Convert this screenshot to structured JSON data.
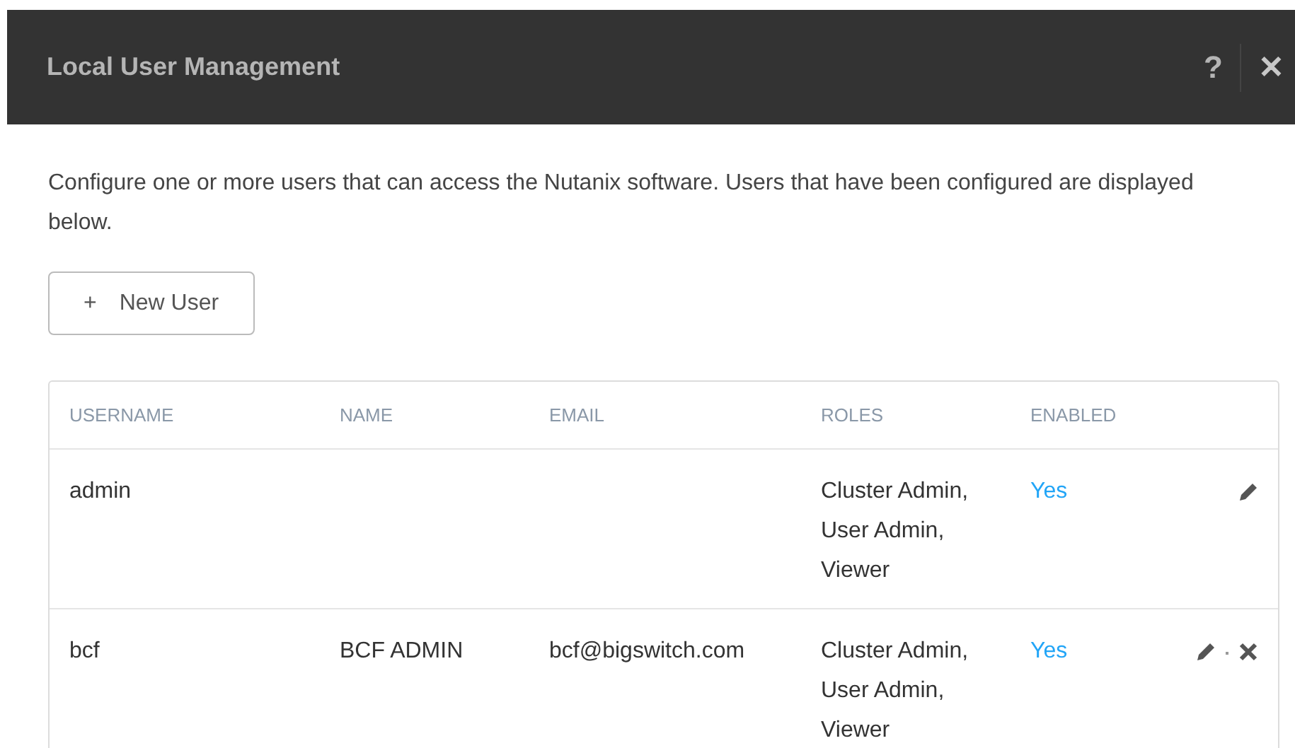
{
  "dialog": {
    "title": "Local User Management",
    "help": "?",
    "close": "✕"
  },
  "description": "Configure one or more users that can access the Nutanix software. Users that have been configured are displayed below.",
  "new_user_button": {
    "icon": "+",
    "label": "New User"
  },
  "table": {
    "columns": [
      "USERNAME",
      "NAME",
      "EMAIL",
      "ROLES",
      "ENABLED"
    ],
    "rows": [
      {
        "username": "admin",
        "roles": "Cluster Admin, User Admin, Viewer",
        "enabled": "Yes",
        "deletable": false
      },
      {
        "username": "bcf",
        "name": "BCF ADMIN",
        "email": "bcf@bigswitch.com",
        "roles": "Cluster Admin, User Admin, Viewer",
        "enabled": "Yes",
        "deletable": true
      }
    ]
  }
}
